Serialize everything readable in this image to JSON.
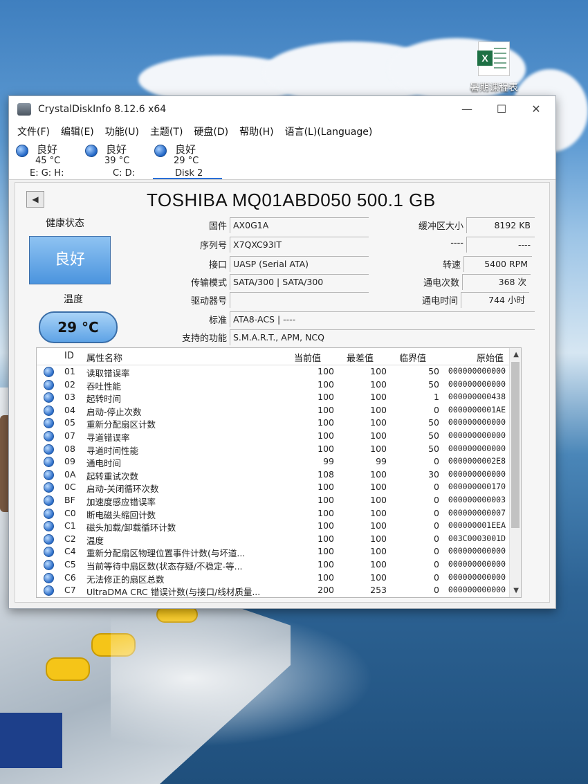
{
  "desktop": {
    "icon_label": "暑期课程表"
  },
  "window": {
    "title": "CrystalDiskInfo 8.12.6 x64",
    "menu": [
      "文件(F)",
      "编辑(E)",
      "功能(U)",
      "主题(T)",
      "硬盘(D)",
      "帮助(H)",
      "语言(L)(Language)"
    ],
    "disks": [
      {
        "status": "良好",
        "temp": "45 °C",
        "label": "E: G: H:"
      },
      {
        "status": "良好",
        "temp": "39 °C",
        "label": "C: D:"
      },
      {
        "status": "良好",
        "temp": "29 °C",
        "label": "Disk 2"
      }
    ],
    "model": "TOSHIBA MQ01ABD050 500.1 GB",
    "health_label": "健康状态",
    "health_value": "良好",
    "temp_label": "温度",
    "temp_value": "29 °C",
    "fields": {
      "firmware_label": "固件",
      "firmware": "AX0G1A",
      "serial_label": "序列号",
      "serial": "X7QXC93IT",
      "interface_label": "接口",
      "interface": "UASP (Serial ATA)",
      "transfer_label": "传输模式",
      "transfer": "SATA/300 | SATA/300",
      "drive_label": "驱动器号",
      "drive": "",
      "standard_label": "标准",
      "standard": "ATA8-ACS | ----",
      "features_label": "支持的功能",
      "features": "S.M.A.R.T., APM, NCQ",
      "buffer_label": "缓冲区大小",
      "buffer": "8192 KB",
      "blank_label": "----",
      "blank": "----",
      "rpm_label": "转速",
      "rpm": "5400 RPM",
      "power_count_label": "通电次数",
      "power_count": "368 次",
      "power_hours_label": "通电时间",
      "power_hours": "744 小时"
    },
    "table": {
      "headers": {
        "id": "ID",
        "name": "属性名称",
        "current": "当前值",
        "worst": "最差值",
        "threshold": "临界值",
        "raw": "原始值"
      },
      "rows": [
        {
          "id": "01",
          "name": "读取错误率",
          "current": "100",
          "worst": "100",
          "threshold": "50",
          "raw": "000000000000"
        },
        {
          "id": "02",
          "name": "吞吐性能",
          "current": "100",
          "worst": "100",
          "threshold": "50",
          "raw": "000000000000"
        },
        {
          "id": "03",
          "name": "起转时间",
          "current": "100",
          "worst": "100",
          "threshold": "1",
          "raw": "000000000438"
        },
        {
          "id": "04",
          "name": "启动-停止次数",
          "current": "100",
          "worst": "100",
          "threshold": "0",
          "raw": "0000000001AE"
        },
        {
          "id": "05",
          "name": "重新分配扇区计数",
          "current": "100",
          "worst": "100",
          "threshold": "50",
          "raw": "000000000000"
        },
        {
          "id": "07",
          "name": "寻道错误率",
          "current": "100",
          "worst": "100",
          "threshold": "50",
          "raw": "000000000000"
        },
        {
          "id": "08",
          "name": "寻道时间性能",
          "current": "100",
          "worst": "100",
          "threshold": "50",
          "raw": "000000000000"
        },
        {
          "id": "09",
          "name": "通电时间",
          "current": "99",
          "worst": "99",
          "threshold": "0",
          "raw": "0000000002E8"
        },
        {
          "id": "0A",
          "name": "起转重试次数",
          "current": "108",
          "worst": "100",
          "threshold": "30",
          "raw": "000000000000"
        },
        {
          "id": "0C",
          "name": "启动-关闭循环次数",
          "current": "100",
          "worst": "100",
          "threshold": "0",
          "raw": "000000000170"
        },
        {
          "id": "BF",
          "name": "加速度感应错误率",
          "current": "100",
          "worst": "100",
          "threshold": "0",
          "raw": "000000000003"
        },
        {
          "id": "C0",
          "name": "断电磁头缩回计数",
          "current": "100",
          "worst": "100",
          "threshold": "0",
          "raw": "000000000007"
        },
        {
          "id": "C1",
          "name": "磁头加载/卸载循环计数",
          "current": "100",
          "worst": "100",
          "threshold": "0",
          "raw": "000000001EEA"
        },
        {
          "id": "C2",
          "name": "温度",
          "current": "100",
          "worst": "100",
          "threshold": "0",
          "raw": "003C0003001D"
        },
        {
          "id": "C4",
          "name": "重新分配扇区物理位置事件计数(与坏道...",
          "current": "100",
          "worst": "100",
          "threshold": "0",
          "raw": "000000000000"
        },
        {
          "id": "C5",
          "name": "当前等待中扇区数(状态存疑/不稳定-等...",
          "current": "100",
          "worst": "100",
          "threshold": "0",
          "raw": "000000000000"
        },
        {
          "id": "C6",
          "name": "无法修正的扇区总数",
          "current": "100",
          "worst": "100",
          "threshold": "0",
          "raw": "000000000000"
        },
        {
          "id": "C7",
          "name": "UltraDMA CRC 错误计数(与接口/线材质量...",
          "current": "200",
          "worst": "253",
          "threshold": "0",
          "raw": "000000000000"
        }
      ]
    }
  }
}
